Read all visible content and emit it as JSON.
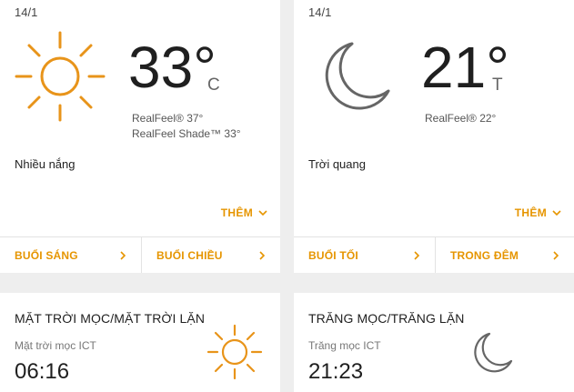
{
  "day_card": {
    "date": "14/1",
    "icon": "sun-icon",
    "temperature": "33°",
    "unit": "C",
    "realfeel": "RealFeel® 37°",
    "realfeel_shade": "RealFeel Shade™ 33°",
    "condition": "Nhiều nắng",
    "more_label": "THÊM",
    "nav": [
      {
        "label": "BUỔI SÁNG"
      },
      {
        "label": "BUỔI CHIỀU"
      }
    ]
  },
  "night_card": {
    "date": "14/1",
    "icon": "moon-icon",
    "temperature": "21°",
    "unit": "T",
    "realfeel": "RealFeel® 22°",
    "condition": "Trời quang",
    "more_label": "THÊM",
    "nav": [
      {
        "label": "BUỔI TỐI"
      },
      {
        "label": "TRONG ĐÊM"
      }
    ]
  },
  "sun_section": {
    "title": "MẶT TRỜI MỌC/MẶT TRỜI LẶN",
    "rise_label": "Mặt trời mọc ICT",
    "rise_time": "06:16",
    "icon": "sun-icon"
  },
  "moon_section": {
    "title": "TRĂNG MỌC/TRĂNG LẶN",
    "rise_label": "Trăng mọc ICT",
    "rise_time": "21:23",
    "icon": "moon-icon"
  },
  "colors": {
    "accent": "#e69500",
    "sun": "#e8941a",
    "moon": "#666666",
    "background": "#eeeeee"
  }
}
